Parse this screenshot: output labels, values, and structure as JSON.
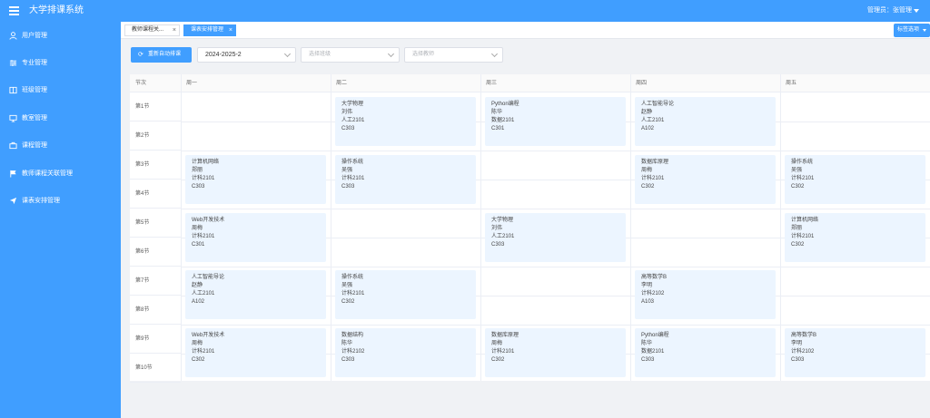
{
  "header": {
    "app_title": "大学排课系统",
    "admin_label": "管理员：张管理",
    "menu_icon": "menu-icon",
    "colors": {
      "primary": "#409eff",
      "course_bg": "#ecf5ff"
    }
  },
  "sidebar": {
    "items": [
      {
        "label": "用户管理",
        "icon": "user-icon"
      },
      {
        "label": "专业管理",
        "icon": "sliders-icon"
      },
      {
        "label": "班级管理",
        "icon": "book-icon"
      },
      {
        "label": "教室管理",
        "icon": "monitor-icon"
      },
      {
        "label": "课程管理",
        "icon": "briefcase-icon"
      },
      {
        "label": "教师课程关联管理",
        "icon": "flag-icon"
      },
      {
        "label": "课表安排管理",
        "icon": "send-icon"
      }
    ]
  },
  "tabs": {
    "items": [
      {
        "label": "教师课程关...",
        "close": "×"
      },
      {
        "label": "课表安排管理",
        "close": "×"
      }
    ],
    "options_label": "标签选项"
  },
  "toolbar": {
    "reschedule_label": "重新自动排课",
    "semester_value": "2024-2025-2",
    "class_placeholder": "选择班级",
    "teacher_placeholder": "选择教师"
  },
  "timetable": {
    "corner_label": "节次",
    "days": [
      "周一",
      "周二",
      "周三",
      "周四",
      "周五"
    ],
    "periods": [
      "第1节",
      "第2节",
      "第3节",
      "第4节",
      "第5节",
      "第6节",
      "第7节",
      "第8节",
      "第9节",
      "第10节"
    ],
    "courses": [
      {
        "day": 2,
        "slot": 1,
        "name": "大学物理",
        "teacher": "刘伟",
        "class": "人工2101",
        "room": "C303"
      },
      {
        "day": 3,
        "slot": 1,
        "name": "Python编程",
        "teacher": "陈华",
        "class": "数据2101",
        "room": "C301"
      },
      {
        "day": 4,
        "slot": 1,
        "name": "人工智能导论",
        "teacher": "赵静",
        "class": "人工2101",
        "room": "A102"
      },
      {
        "day": 1,
        "slot": 2,
        "name": "计算机网络",
        "teacher": "郑丽",
        "class": "计科2101",
        "room": "C303"
      },
      {
        "day": 2,
        "slot": 2,
        "name": "操作系统",
        "teacher": "吴强",
        "class": "计科2101",
        "room": "C303"
      },
      {
        "day": 4,
        "slot": 2,
        "name": "数据库原理",
        "teacher": "周梅",
        "class": "计科2101",
        "room": "C302"
      },
      {
        "day": 5,
        "slot": 2,
        "name": "操作系统",
        "teacher": "吴强",
        "class": "计科2101",
        "room": "C302"
      },
      {
        "day": 1,
        "slot": 3,
        "name": "Web开发技术",
        "teacher": "周梅",
        "class": "计科2101",
        "room": "C301"
      },
      {
        "day": 3,
        "slot": 3,
        "name": "大学物理",
        "teacher": "刘伟",
        "class": "人工2101",
        "room": "C303"
      },
      {
        "day": 5,
        "slot": 3,
        "name": "计算机网络",
        "teacher": "郑丽",
        "class": "计科2101",
        "room": "C302"
      },
      {
        "day": 1,
        "slot": 4,
        "name": "人工智能导论",
        "teacher": "赵静",
        "class": "人工2101",
        "room": "A102"
      },
      {
        "day": 2,
        "slot": 4,
        "name": "操作系统",
        "teacher": "吴强",
        "class": "计科2101",
        "room": "C302"
      },
      {
        "day": 4,
        "slot": 4,
        "name": "高等数学B",
        "teacher": "李明",
        "class": "计科2102",
        "room": "A103"
      },
      {
        "day": 1,
        "slot": 5,
        "name": "Web开发技术",
        "teacher": "周梅",
        "class": "计科2101",
        "room": "C302"
      },
      {
        "day": 2,
        "slot": 5,
        "name": "数据结构",
        "teacher": "陈华",
        "class": "计科2102",
        "room": "C303"
      },
      {
        "day": 3,
        "slot": 5,
        "name": "数据库原理",
        "teacher": "周梅",
        "class": "计科2101",
        "room": "C302"
      },
      {
        "day": 4,
        "slot": 5,
        "name": "Python编程",
        "teacher": "陈华",
        "class": "数据2101",
        "room": "C303"
      },
      {
        "day": 5,
        "slot": 5,
        "name": "高等数学B",
        "teacher": "李明",
        "class": "计科2102",
        "room": "C303"
      }
    ]
  }
}
